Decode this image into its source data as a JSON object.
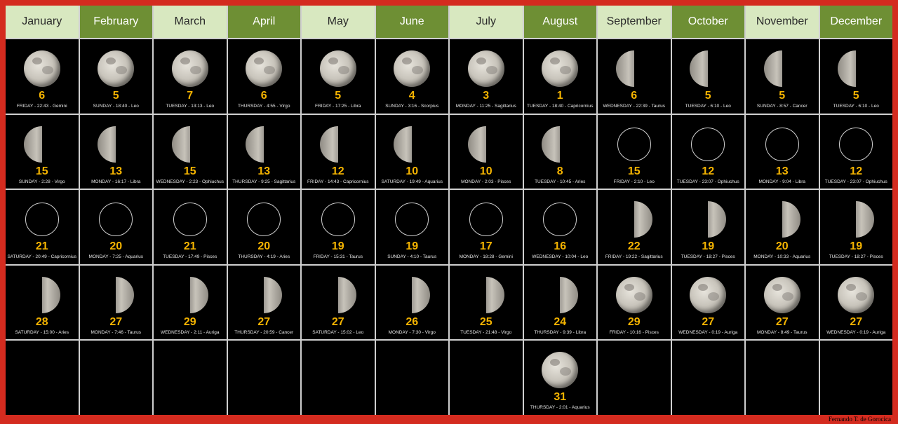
{
  "months": [
    "January",
    "February",
    "March",
    "April",
    "May",
    "June",
    "July",
    "August",
    "September",
    "October",
    "November",
    "December"
  ],
  "rows": [
    [
      {
        "phase": "full",
        "day": "6",
        "info": "FRIDAY - 22:43 - Gemini"
      },
      {
        "phase": "full",
        "day": "5",
        "info": "SUNDAY - 18:40 - Leo"
      },
      {
        "phase": "full",
        "day": "7",
        "info": "TUESDAY - 13:13 - Leo"
      },
      {
        "phase": "full",
        "day": "6",
        "info": "THURSDAY - 4:55 - Virgo"
      },
      {
        "phase": "full",
        "day": "5",
        "info": "FRIDAY - 17:25 - Libra"
      },
      {
        "phase": "full",
        "day": "4",
        "info": "SUNDAY - 3:16 - Scorpius"
      },
      {
        "phase": "full",
        "day": "3",
        "info": "MONDAY - 11:25 - Sagittarius"
      },
      {
        "phase": "full",
        "day": "1",
        "info": "TUESDAY - 18:40 - Capricornius"
      },
      {
        "phase": "last",
        "day": "6",
        "info": "WEDNESDAY - 22:39 - Taurus"
      },
      {
        "phase": "last",
        "day": "5",
        "info": "TUESDAY - 6:10 - Leo"
      },
      {
        "phase": "last",
        "day": "5",
        "info": "SUNDAY - 8:57 - Cancer"
      },
      {
        "phase": "last",
        "day": "5",
        "info": "TUESDAY - 6:10 - Leo"
      }
    ],
    [
      {
        "phase": "last",
        "day": "15",
        "info": "SUNDAY - 2:28 - Virgo"
      },
      {
        "phase": "last",
        "day": "13",
        "info": "MONDAY - 16:17 - Libra"
      },
      {
        "phase": "last",
        "day": "15",
        "info": "WEDNESDAY - 2:23 - Ophiuchus"
      },
      {
        "phase": "last",
        "day": "13",
        "info": "THURSDAY - 9:25 - Sagittarius"
      },
      {
        "phase": "last",
        "day": "12",
        "info": "FRIDAY - 14:43 - Capricornius"
      },
      {
        "phase": "last",
        "day": "10",
        "info": "SATURDAY - 19:49 - Aquarius"
      },
      {
        "phase": "last",
        "day": "10",
        "info": "MONDAY - 2:03 - Pisces"
      },
      {
        "phase": "last",
        "day": "8",
        "info": "TUESDAY - 10:45 - Aries"
      },
      {
        "phase": "new",
        "day": "15",
        "info": "FRIDAY - 2:10 - Leo"
      },
      {
        "phase": "new",
        "day": "12",
        "info": "TUESDAY - 23:07 - Ophiuchus"
      },
      {
        "phase": "new",
        "day": "13",
        "info": "MONDAY - 9:04 - Libra"
      },
      {
        "phase": "new",
        "day": "12",
        "info": "TUESDAY - 23:07 - Ophiuchus"
      }
    ],
    [
      {
        "phase": "new",
        "day": "21",
        "info": "SATURDAY - 20:49 - Capricornius"
      },
      {
        "phase": "new",
        "day": "20",
        "info": "MONDAY - 7:25 - Aquarius"
      },
      {
        "phase": "new",
        "day": "21",
        "info": "TUESDAY - 17:49 - Pisces"
      },
      {
        "phase": "new",
        "day": "20",
        "info": "THURSDAY - 4:19 - Aries"
      },
      {
        "phase": "new",
        "day": "19",
        "info": "FRIDAY - 15:31 - Taurus"
      },
      {
        "phase": "new",
        "day": "19",
        "info": "SUNDAY - 4:10 - Taurus"
      },
      {
        "phase": "new",
        "day": "17",
        "info": "MONDAY - 18:28 - Gemini"
      },
      {
        "phase": "new",
        "day": "16",
        "info": "WEDNESDAY - 10:04 - Leo"
      },
      {
        "phase": "first",
        "day": "22",
        "info": "FRIDAY - 19:22 - Sagittarius"
      },
      {
        "phase": "first",
        "day": "19",
        "info": "TUESDAY - 18:27 - Pisces"
      },
      {
        "phase": "first",
        "day": "20",
        "info": "MONDAY - 10:33 - Aquarius"
      },
      {
        "phase": "first",
        "day": "19",
        "info": "TUESDAY - 18:27 - Pisces"
      }
    ],
    [
      {
        "phase": "first",
        "day": "28",
        "info": "SATURDAY - 15:00 - Aries"
      },
      {
        "phase": "first",
        "day": "27",
        "info": "MONDAY - 7:46 - Taurus"
      },
      {
        "phase": "first",
        "day": "29",
        "info": "WEDNESDAY - 2:11 - Auriga"
      },
      {
        "phase": "first",
        "day": "27",
        "info": "THURSDAY - 20:59 - Cancer"
      },
      {
        "phase": "first",
        "day": "27",
        "info": "SATURDAY - 15:02 - Leo"
      },
      {
        "phase": "first",
        "day": "26",
        "info": "MONDAY - 7:30 - Virgo"
      },
      {
        "phase": "first",
        "day": "25",
        "info": "TUESDAY - 21:48 - Virgo"
      },
      {
        "phase": "first",
        "day": "24",
        "info": "THURSDAY - 9:39 - Libra"
      },
      {
        "phase": "full",
        "day": "29",
        "info": "FRIDAY - 10:16 - Pisces"
      },
      {
        "phase": "full",
        "day": "27",
        "info": "WEDNESDAY - 0:19 - Auriga"
      },
      {
        "phase": "full",
        "day": "27",
        "info": "MONDAY - 8:49 - Taurus"
      },
      {
        "phase": "full",
        "day": "27",
        "info": "WEDNESDAY - 0:19 - Auriga"
      }
    ],
    [
      null,
      null,
      null,
      null,
      null,
      null,
      null,
      {
        "phase": "full",
        "day": "31",
        "info": "THURSDAY - 2:01 - Aquarius"
      },
      null,
      null,
      null,
      null
    ]
  ],
  "credit": "Fernando T. de Gorocica",
  "colors": {
    "border": "#d42b1f",
    "header_light": "#d8e8c0",
    "header_dark": "#6e8f34",
    "day": "#f5b400"
  }
}
